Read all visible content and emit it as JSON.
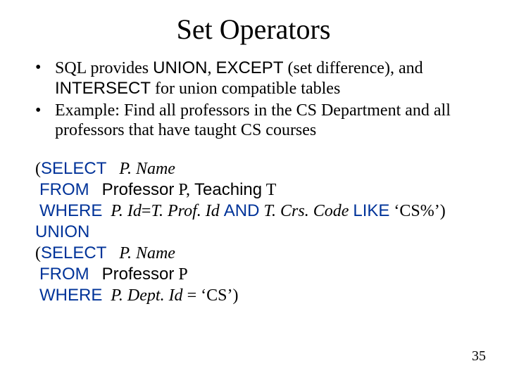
{
  "title": "Set Operators",
  "bullets": {
    "b1": {
      "t1": "SQL provides ",
      "t2": "UNION",
      "t3": ", ",
      "t4": "EXCEPT",
      "t5": " (set difference), and ",
      "t6": "INTERSECT",
      "t7": "  for union compatible tables"
    },
    "b2": "Example:  Find all professors in the CS Department and all professors that have taught CS courses"
  },
  "sql": {
    "l1": {
      "a": "(",
      "kw": "SELECT",
      "b": "   ",
      "expr": "P. Name"
    },
    "l2": {
      "a": " ",
      "kw": "FROM",
      "b": "   ",
      "t1": "Professor",
      "c": " P, ",
      "t2": "Teaching",
      "d": " T"
    },
    "l3": {
      "a": " ",
      "kw": "WHERE",
      "b": "  ",
      "e1": "P. Id",
      "c": "=",
      "e2": "T. Prof. Id",
      "d": " ",
      "kw2": "AND",
      "e": " ",
      "e3": "T. Crs. Code",
      "f": " ",
      "kw3": "LIKE",
      "g": " ‘CS%’)"
    },
    "l4": {
      "kw": "UNION"
    },
    "l5": {
      "a": "(",
      "kw": "SELECT",
      "b": "   ",
      "expr": "P. Name"
    },
    "l6": {
      "a": " ",
      "kw": "FROM",
      "b": "   ",
      "t1": "Professor",
      "c": " P"
    },
    "l7": {
      "a": " ",
      "kw": "WHERE",
      "b": "  ",
      "e1": "P. Dept. Id",
      "c": " = ‘CS’)"
    }
  },
  "pagenum": "35"
}
